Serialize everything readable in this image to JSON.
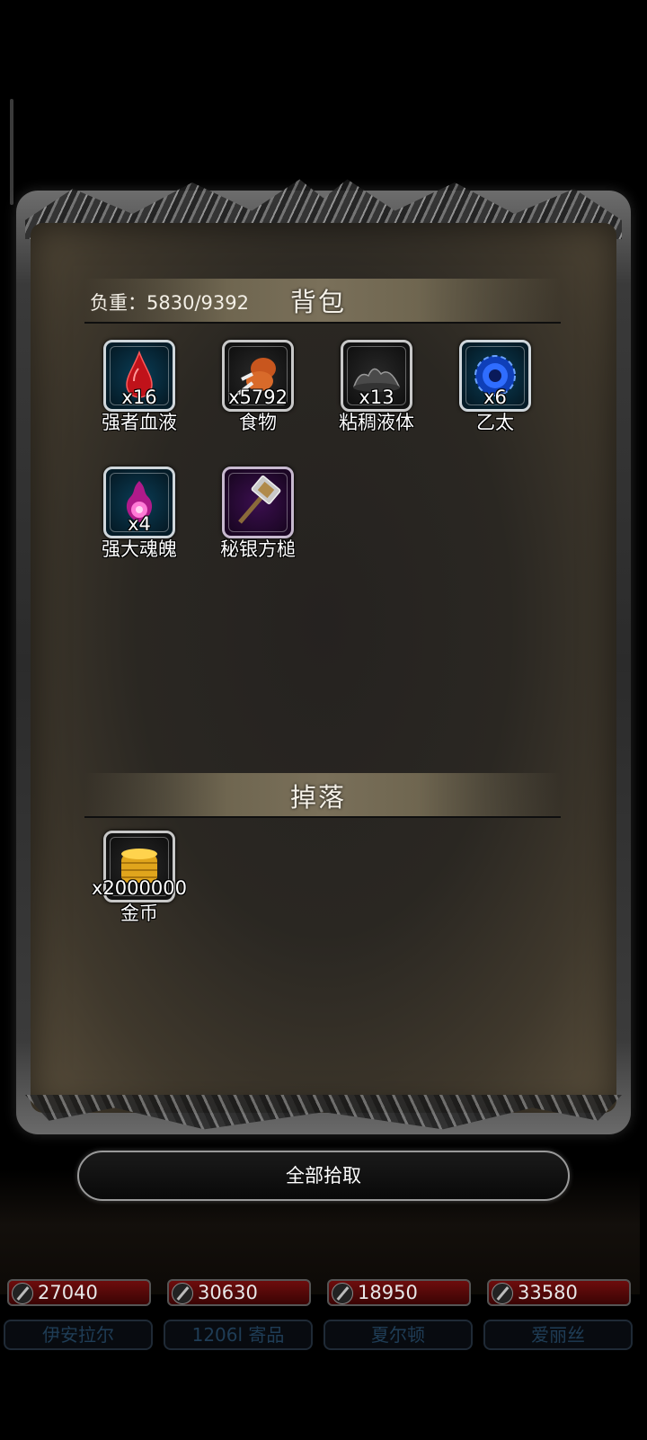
{
  "inventory": {
    "weight_label": "负重：5830/9392",
    "title": "背包",
    "items": [
      {
        "name": "强者血液",
        "count": "x16",
        "icon": "blood-drop-icon"
      },
      {
        "name": "食物",
        "count": "x5792",
        "icon": "meat-food-icon"
      },
      {
        "name": "粘稠液体",
        "count": "x13",
        "icon": "sticky-liquid-icon"
      },
      {
        "name": "乙太",
        "count": "x6",
        "icon": "ether-orb-icon"
      },
      {
        "name": "强大魂魄",
        "count": "x4",
        "icon": "soul-orb-icon"
      },
      {
        "name": "秘银方槌",
        "count": "",
        "icon": "mithril-hammer-icon"
      }
    ]
  },
  "drops": {
    "title": "掉落",
    "items": [
      {
        "name": "金币",
        "count": "x2000000",
        "icon": "gold-coins-icon"
      }
    ]
  },
  "pickup_all_label": "全部拾取",
  "party": [
    {
      "hp": "27040",
      "name": "伊安拉尔"
    },
    {
      "hp": "30630",
      "name": "1206l 寄品"
    },
    {
      "hp": "18950",
      "name": "夏尔顿"
    },
    {
      "hp": "33580",
      "name": "爱丽丝"
    }
  ],
  "colors": {
    "background": "#000000",
    "parchment": "#2a2722",
    "hp_bar": "#6e0d0d",
    "slot_blue": "#0b3e57",
    "slot_purple": "#3b0f4f"
  }
}
